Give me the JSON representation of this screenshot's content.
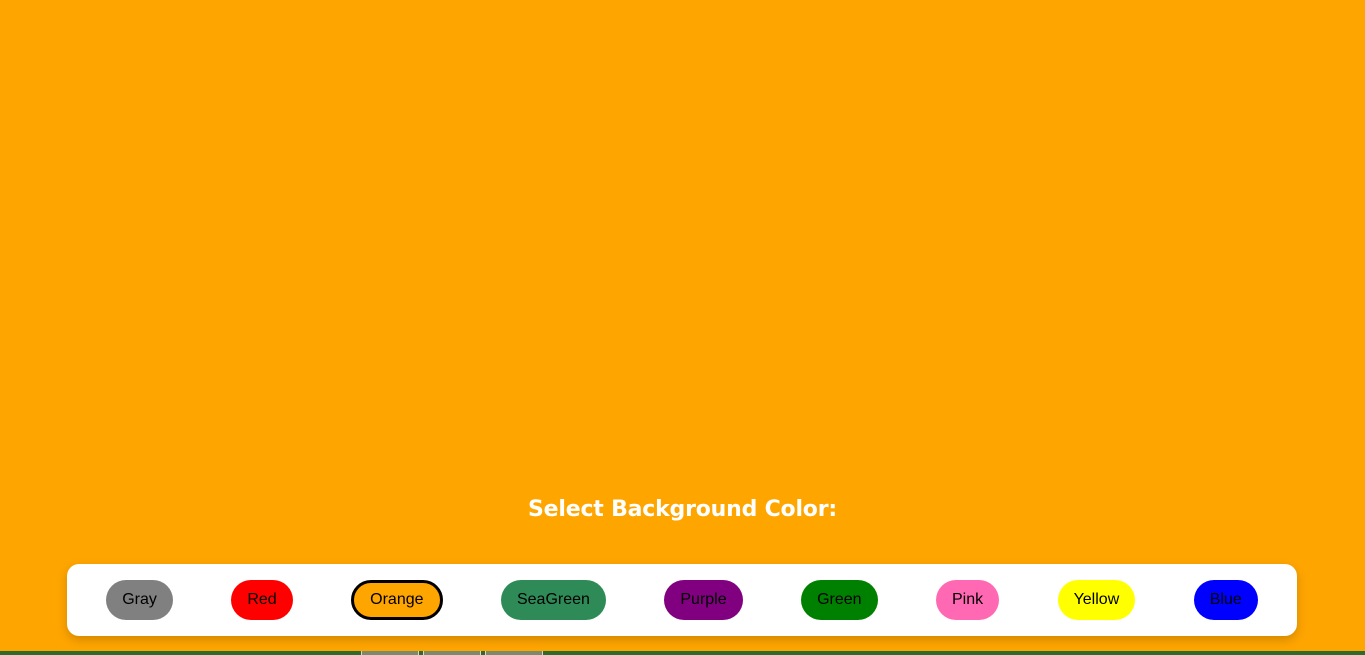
{
  "page": {
    "background_color": "#FFA500",
    "heading": "Select Background Color:"
  },
  "toolbar": {
    "selected": "Orange",
    "buttons": [
      {
        "label": "Gray",
        "color": "#808080"
      },
      {
        "label": "Red",
        "color": "#FF0000"
      },
      {
        "label": "Orange",
        "color": "#FFA500"
      },
      {
        "label": "SeaGreen",
        "color": "#2E8B57"
      },
      {
        "label": "Purple",
        "color": "#800080"
      },
      {
        "label": "Green",
        "color": "#008000"
      },
      {
        "label": "Pink",
        "color": "#FF69B4"
      },
      {
        "label": "Yellow",
        "color": "#FFFF00"
      },
      {
        "label": "Blue",
        "color": "#0000FF"
      }
    ]
  }
}
